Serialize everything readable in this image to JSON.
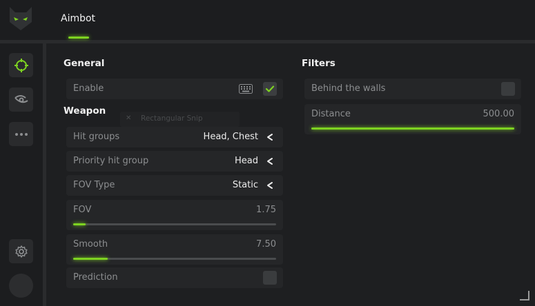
{
  "header": {
    "tab_label": "Aimbot"
  },
  "sidebar": {
    "items": [
      {
        "icon": "crosshair-icon",
        "active": true
      },
      {
        "icon": "eye-icon",
        "active": false
      },
      {
        "icon": "more-icon",
        "active": false
      }
    ],
    "settings_icon": "gear-icon"
  },
  "general": {
    "title": "General",
    "enable_label": "Enable",
    "enable_checked": true
  },
  "weapon": {
    "title": "Weapon",
    "hit_groups_label": "Hit groups",
    "hit_groups_value": "Head, Chest",
    "priority_label": "Priority hit group",
    "priority_value": "Head",
    "fov_type_label": "FOV Type",
    "fov_type_value": "Static",
    "fov_label": "FOV",
    "fov_value": "1.75",
    "fov_fill_fraction": 0.06,
    "smooth_label": "Smooth",
    "smooth_value": "7.50",
    "smooth_fill_fraction": 0.17,
    "prediction_label": "Prediction",
    "prediction_checked": false
  },
  "filters": {
    "title": "Filters",
    "walls_label": "Behind the walls",
    "walls_checked": false,
    "distance_label": "Distance",
    "distance_value": "500.00",
    "distance_fill_fraction": 1.0
  },
  "drag_ghost": {
    "text": "Rectangular Snip"
  },
  "colors": {
    "accent": "#7ed321",
    "background": "#1e1f21",
    "row": "#252628"
  }
}
